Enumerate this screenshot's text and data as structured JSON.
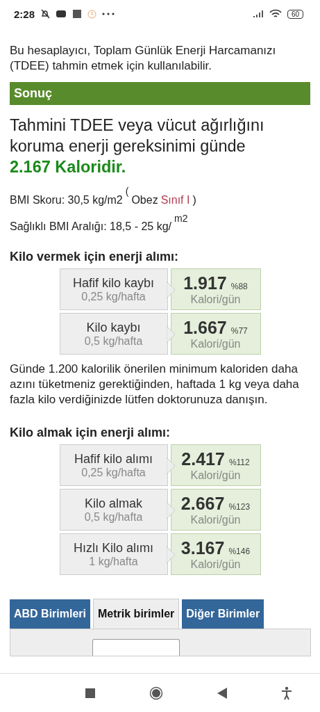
{
  "status_bar": {
    "time": "2:28",
    "battery": "60"
  },
  "intro": "Bu hesaplayıcı, Toplam Günlük Enerji Harcamanızı (TDEE) tahmin etmek için kullanılabilir.",
  "result_header": "Sonuç",
  "result": {
    "text": "Tahmini TDEE veya vücut ağırlığını koruma enerji gereksinimi günde",
    "value": "2.167 Kaloridir."
  },
  "bmi": {
    "score": "BMI Skoru: 30,5 kg/m2",
    "open": "(",
    "category": "Obez",
    "class": "Sınıf I",
    "close": ")",
    "range": "Sağlıklı BMI Aralığı: 18,5 - 25 kg/",
    "range_unit": "m2"
  },
  "loss": {
    "title": "Kilo vermek için enerji alımı:",
    "rows": [
      {
        "name": "Hafif kilo kaybı",
        "rate": "0,25 kg/hafta",
        "calories": "1.917",
        "percent": "%88",
        "unit": "Kalori/gün"
      },
      {
        "name": "Kilo kaybı",
        "rate": "0,5 kg/hafta",
        "calories": "1.667",
        "percent": "%77",
        "unit": "Kalori/gün"
      }
    ]
  },
  "warning": "Günde 1.200 kalorilik önerilen minimum kaloriden daha azını tüketmeniz gerektiğinden, haftada 1 kg veya daha fazla kilo verdiğinizde lütfen doktorunuza danışın.",
  "gain": {
    "title": "Kilo almak için enerji alımı:",
    "rows": [
      {
        "name": "Hafif kilo alımı",
        "rate": "0,25 kg/hafta",
        "calories": "2.417",
        "percent": "%112",
        "unit": "Kalori/gün"
      },
      {
        "name": "Kilo almak",
        "rate": "0,5 kg/hafta",
        "calories": "2.667",
        "percent": "%123",
        "unit": "Kalori/gün"
      },
      {
        "name": "Hızlı Kilo alımı",
        "rate": "1 kg/hafta",
        "calories": "3.167",
        "percent": "%146",
        "unit": "Kalori/gün"
      }
    ]
  },
  "tabs": [
    {
      "label": "ABD Birimleri",
      "selected": false
    },
    {
      "label": "Metrik birimler",
      "selected": true
    },
    {
      "label": "Diğer Birimler",
      "selected": false
    }
  ]
}
